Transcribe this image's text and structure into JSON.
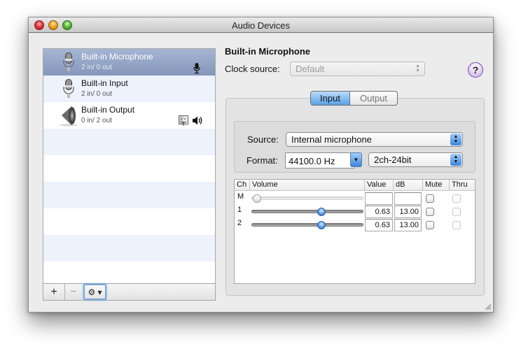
{
  "window": {
    "title": "Audio Devices"
  },
  "devices": [
    {
      "name": "Built-in Microphone",
      "io": "2 in/ 0 out",
      "icon": "microphone-icon",
      "selected": true,
      "badges": [
        "input-default-mic-icon"
      ]
    },
    {
      "name": "Built-in Input",
      "io": "2 in/ 0 out",
      "icon": "microphone-icon",
      "selected": false,
      "badges": []
    },
    {
      "name": "Built-in Output",
      "io": "0 in/ 2 out",
      "icon": "speaker-icon",
      "selected": false,
      "badges": [
        "finder-system-output-icon",
        "speaker-output-icon"
      ]
    }
  ],
  "list_toolbar": {
    "add_label": "+",
    "remove_label": "−",
    "gear_label": "⚙ ▾"
  },
  "detail": {
    "device_title": "Built-in Microphone",
    "clock_source_label": "Clock source:",
    "clock_source_value": "Default",
    "help_label": "?",
    "tabs": [
      {
        "label": "Input",
        "active": true
      },
      {
        "label": "Output",
        "active": false
      }
    ],
    "source_label": "Source:",
    "source_value": "Internal microphone",
    "format_label": "Format:",
    "sample_rate": "44100.0 Hz",
    "bit_format": "2ch-24bit"
  },
  "channel_table": {
    "headers": [
      "Ch",
      "Volume",
      "Value",
      "dB",
      "Mute",
      "Thru"
    ],
    "rows": [
      {
        "ch": "M",
        "volume": 0.0,
        "enabled": false,
        "value": "",
        "db": "",
        "mute": false,
        "thru": false
      },
      {
        "ch": "1",
        "volume": 0.63,
        "enabled": true,
        "value": "0.63",
        "db": "13.00",
        "mute": false,
        "thru": false
      },
      {
        "ch": "2",
        "volume": 0.63,
        "enabled": true,
        "value": "0.63",
        "db": "13.00",
        "mute": false,
        "thru": false
      }
    ]
  },
  "colors": {
    "selection": "#8e9fc2",
    "alt_row": "#edf2fd",
    "accent_blue": "#5aa1e8",
    "help_purple": "#c7a7e6"
  }
}
